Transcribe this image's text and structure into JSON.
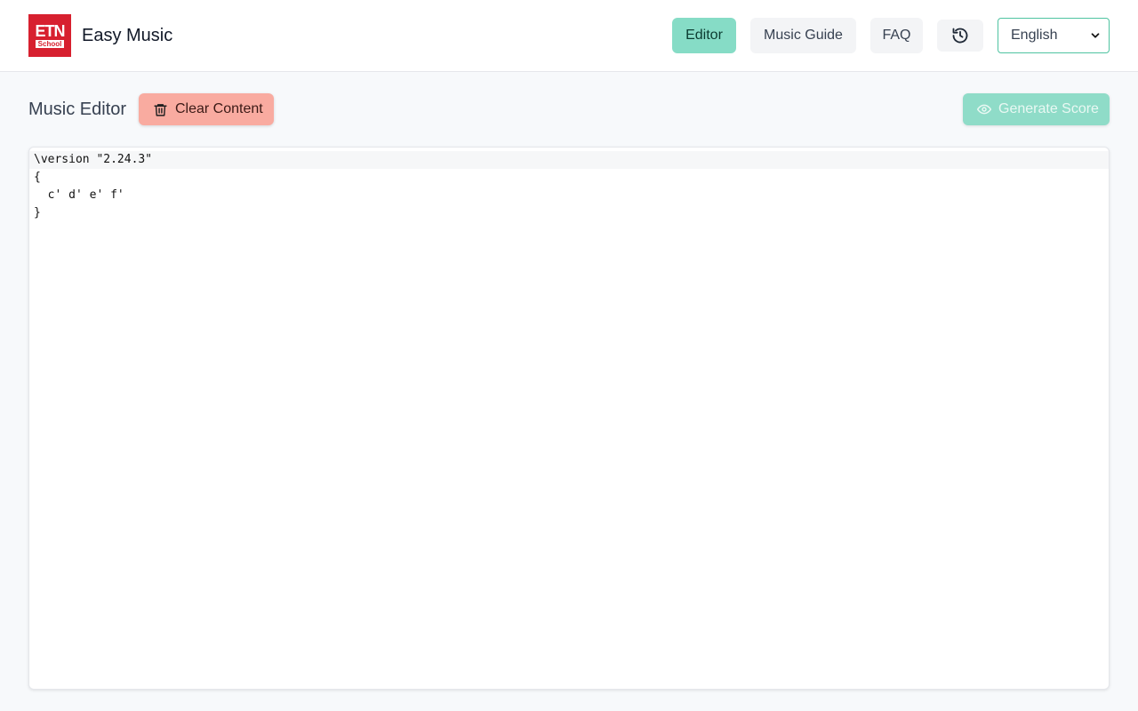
{
  "header": {
    "logo": {
      "main_text": "ETN",
      "sub_text": "School"
    },
    "app_title": "Easy Music",
    "nav": [
      {
        "label": "Editor",
        "active": true
      },
      {
        "label": "Music Guide",
        "active": false
      },
      {
        "label": "FAQ",
        "active": false
      }
    ],
    "history_icon": "history-icon",
    "language": {
      "selected": "English",
      "options": [
        "English"
      ]
    }
  },
  "toolbar": {
    "section_title": "Music Editor",
    "clear_label": "Clear Content",
    "generate_label": "Generate Score",
    "clear_icon": "trash-icon",
    "generate_icon": "eye-icon"
  },
  "editor": {
    "lines": [
      "\\version \"2.24.3\"",
      "{",
      "  c' d' e' f'",
      "}"
    ]
  },
  "colors": {
    "accent": "#86dcc6",
    "danger": "#f9aba0",
    "logo_red": "#d7202f",
    "select_border": "#4fc3a1"
  }
}
